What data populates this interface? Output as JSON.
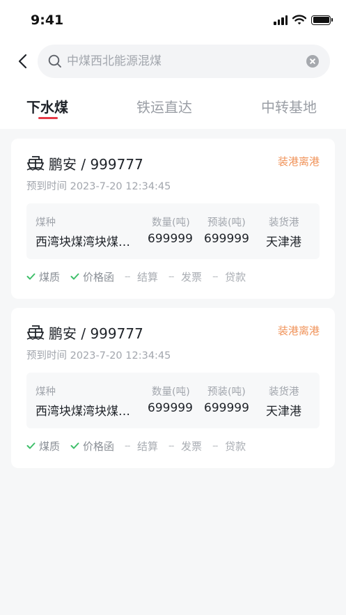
{
  "status_bar": {
    "time": "9:41"
  },
  "search": {
    "value": "",
    "placeholder": "中煤西北能源混煤"
  },
  "tabs": [
    {
      "label": "下水煤",
      "active": true
    },
    {
      "label": "铁运直达",
      "active": false
    },
    {
      "label": "中转基地",
      "active": false
    }
  ],
  "colors": {
    "accent": "#e63946",
    "status": "#f0935a",
    "done_check": "#3fbf6a"
  },
  "cards": [
    {
      "title": "鹏安 / 999777",
      "status": "装港离港",
      "eta": "预到时间 2023-7-20 12:34:45",
      "headers": [
        "煤种",
        "数量(吨)",
        "预装(吨)",
        "装货港"
      ],
      "values": [
        "西湾块煤湾块煤块煤",
        "699999",
        "699999",
        "天津港"
      ],
      "steps": [
        {
          "label": "煤质",
          "done": true
        },
        {
          "label": "价格函",
          "done": true
        },
        {
          "label": "结算",
          "done": false
        },
        {
          "label": "发票",
          "done": false
        },
        {
          "label": "贷款",
          "done": false
        }
      ]
    },
    {
      "title": "鹏安 / 999777",
      "status": "装港离港",
      "eta": "预到时间 2023-7-20 12:34:45",
      "headers": [
        "煤种",
        "数量(吨)",
        "预装(吨)",
        "装货港"
      ],
      "values": [
        "西湾块煤湾块煤块煤",
        "699999",
        "699999",
        "天津港"
      ],
      "steps": [
        {
          "label": "煤质",
          "done": true
        },
        {
          "label": "价格函",
          "done": true
        },
        {
          "label": "结算",
          "done": false
        },
        {
          "label": "发票",
          "done": false
        },
        {
          "label": "贷款",
          "done": false
        }
      ]
    }
  ]
}
